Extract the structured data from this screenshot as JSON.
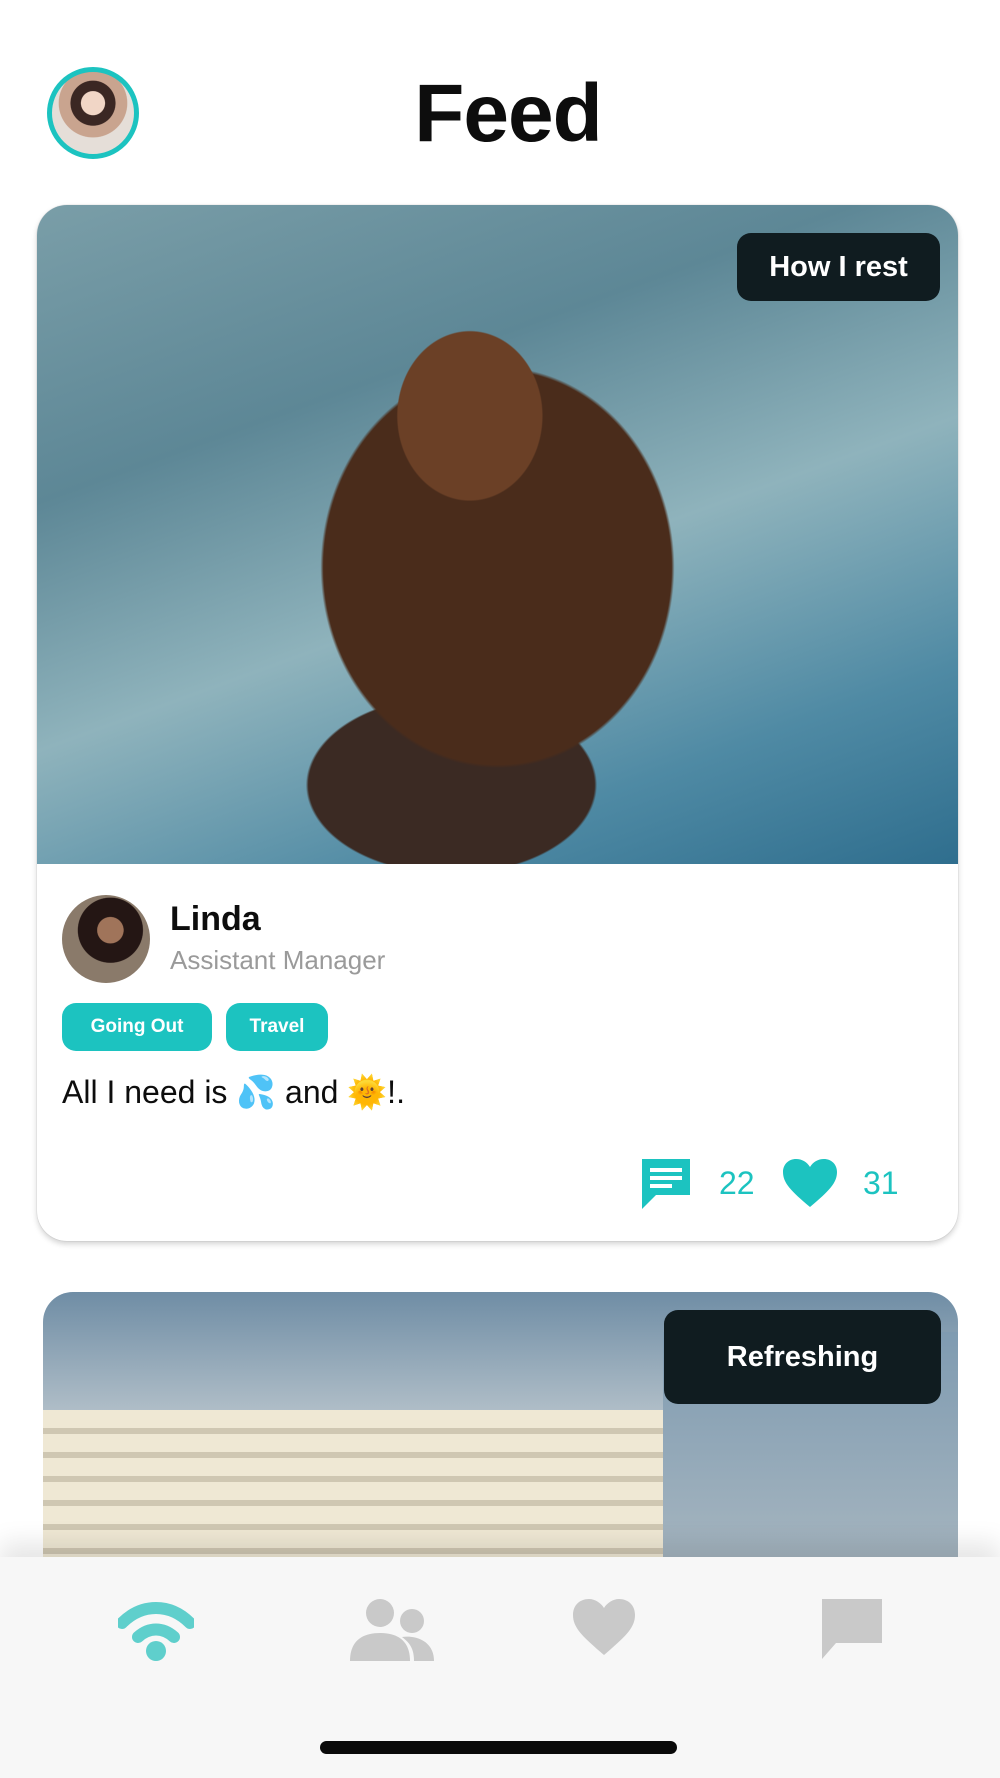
{
  "header": {
    "title": "Feed",
    "avatar_icon": "user-avatar"
  },
  "posts": [
    {
      "label": "How I rest",
      "author": {
        "name": "Linda",
        "role": "Assistant Manager"
      },
      "tags": [
        "Going Out",
        "Travel"
      ],
      "text": "All I need is 💦 and 🌞!.",
      "comments": "22",
      "likes": "31"
    },
    {
      "label": "Refreshing"
    }
  ],
  "tab_bar": {
    "items": [
      {
        "icon": "feed-icon",
        "active": true
      },
      {
        "icon": "friends-icon",
        "active": false
      },
      {
        "icon": "heart-icon",
        "active": false
      },
      {
        "icon": "chat-icon",
        "active": false
      }
    ]
  },
  "colors": {
    "accent": "#1cc3c0",
    "label_bg": "#101c20",
    "inactive_icon": "#c9c9c9",
    "muted_text": "#9a9a9a"
  }
}
